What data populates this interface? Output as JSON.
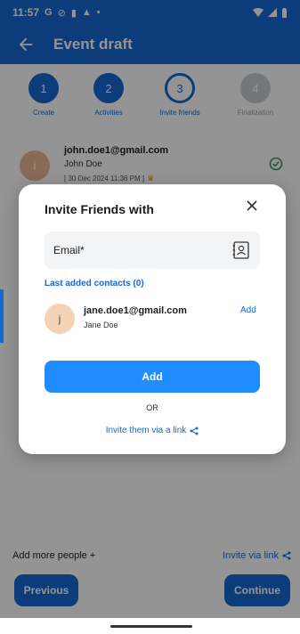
{
  "status_bar": {
    "time": "11:57",
    "icons": [
      "google-g-icon",
      "blocked-icon",
      "clipboard-icon",
      "alert-icon",
      "dot-icon"
    ],
    "right_icons": [
      "wifi-icon",
      "signal-icon",
      "battery-icon"
    ]
  },
  "app_bar": {
    "title": "Event draft",
    "back_icon": "arrow-left-icon"
  },
  "stepper": {
    "steps": [
      {
        "number": "1",
        "label": "Create",
        "state": "done"
      },
      {
        "number": "2",
        "label": "Activities",
        "state": "done"
      },
      {
        "number": "3",
        "label": "Invite friends",
        "state": "current"
      },
      {
        "number": "4",
        "label": "Finalization",
        "state": "future"
      }
    ]
  },
  "invited": {
    "avatar_initial": "i",
    "email": "john.doe1@gmail.com",
    "name": "John Doe",
    "date": "[ 30 Dec 2024 11:36 PM ]",
    "status_icon": "check-circle-icon"
  },
  "footer": {
    "add_more": "Add more people +",
    "invite_via_link": "Invite via link"
  },
  "buttons": {
    "previous": "Previous",
    "continue": "Continue"
  },
  "dialog": {
    "title": "Invite Friends with",
    "email_placeholder": "Email*",
    "last_added": "Last added contacts (0)",
    "contact": {
      "avatar_initial": "j",
      "email": "jane.doe1@gmail.com",
      "name": "Jane Doe",
      "add_label": "Add"
    },
    "add_button": "Add",
    "or": "OR",
    "invite_link": "Invite them via a link"
  },
  "colors": {
    "primary": "#1669d3",
    "button": "#1f8cff",
    "scrim": "rgba(0,0,0,0.42)"
  }
}
